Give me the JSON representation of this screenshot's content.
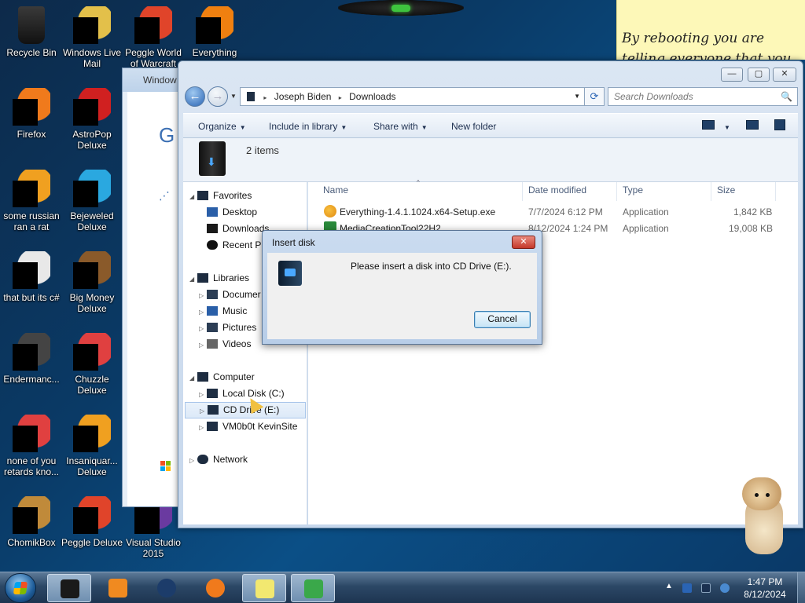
{
  "desktop": {
    "icons": [
      {
        "label": "Recycle Bin",
        "icon": "recycle-bin-icon",
        "color": "#2b2b2b"
      },
      {
        "label": "Windows Live Mail",
        "icon": "mail-icon",
        "color": "#e3c04a"
      },
      {
        "label": "Peggle World of Warcraft",
        "icon": "peggle-icon",
        "color": "#e0442a"
      },
      {
        "label": "Everything",
        "icon": "search-icon",
        "color": "#f08010"
      },
      {
        "label": "Firefox",
        "icon": "firefox-icon",
        "color": "#f07a1c"
      },
      {
        "label": "AstroPop Deluxe",
        "icon": "game-icon",
        "color": "#d02020"
      },
      {
        "label": "some russian ran a rat",
        "icon": "app-icon",
        "color": "#f0a020"
      },
      {
        "label": "Bejeweled Deluxe",
        "icon": "gem-icon",
        "color": "#2aa8e0"
      },
      {
        "label": "that but its c#",
        "icon": "file-icon",
        "color": "#e8e8e8"
      },
      {
        "label": "Big Money Deluxe",
        "icon": "money-icon",
        "color": "#8a5a2a"
      },
      {
        "label": "Endermanc...",
        "icon": "app-icon",
        "color": "#444444"
      },
      {
        "label": "Chuzzle Deluxe",
        "icon": "game-icon",
        "color": "#e04040"
      },
      {
        "label": "none of you retards kno...",
        "icon": "app-icon",
        "color": "#e04040"
      },
      {
        "label": "Insaniquar... Deluxe",
        "icon": "fish-icon",
        "color": "#f0a020"
      },
      {
        "label": "ChomikBox",
        "icon": "hamster-icon",
        "color": "#c08a3a"
      },
      {
        "label": "Peggle Deluxe",
        "icon": "peggle-icon",
        "color": "#e0442a"
      },
      {
        "label": "Visual Studio 2015",
        "icon": "visual-studio-icon",
        "color": "#6a3aa0"
      }
    ],
    "sticky_note": "By rebooting you are telling everyone that you are"
  },
  "background_window": {
    "title": "Window",
    "letter": "G",
    "spinner": "⋰"
  },
  "explorer": {
    "controls": {
      "minimize": "—",
      "maximize": "▢",
      "close": "✕"
    },
    "nav": {
      "back": "←",
      "forward": "→",
      "dropdown": "▼"
    },
    "address": {
      "segments": [
        "Joseph Biden",
        "Downloads"
      ],
      "separator": "▸",
      "dropdown": "▼"
    },
    "refresh": "⟳",
    "search": {
      "placeholder": "Search Downloads",
      "icon": "🔍"
    },
    "toolbar": {
      "organize": "Organize",
      "include_in_library": "Include in library",
      "share_with": "Share with",
      "new_folder": "New folder",
      "dropdown": "▼"
    },
    "info": {
      "count": "2 items"
    },
    "navpane": {
      "favorites": {
        "label": "Favorites",
        "items": [
          "Desktop",
          "Downloads",
          "Recent Pl"
        ]
      },
      "libraries": {
        "label": "Libraries",
        "items": [
          "Documer",
          "Music",
          "Pictures",
          "Videos"
        ]
      },
      "computer": {
        "label": "Computer",
        "items": [
          "Local Disk (C:)",
          "CD Drive (E:)",
          "VM0b0t KevinSite"
        ]
      },
      "network": {
        "label": "Network"
      },
      "expand_open": "◢",
      "expand_closed": "▷"
    },
    "columns": {
      "name": "Name",
      "date_modified": "Date modified",
      "type": "Type",
      "size": "Size",
      "sort": "^"
    },
    "files": [
      {
        "name": "Everything-1.4.1.1024.x64-Setup.exe",
        "date": "7/7/2024 6:12 PM",
        "type": "Application",
        "size": "1,842 KB",
        "icon_color": "#e08a10"
      },
      {
        "name": "MediaCreationTool22H2",
        "date": "8/12/2024 1:24 PM",
        "type": "Application",
        "size": "19,008 KB",
        "icon_color": "#2a8a3a"
      }
    ]
  },
  "dialog": {
    "title": "Insert disk",
    "close": "✕",
    "message": "Please insert a disk into CD Drive (E:).",
    "cancel": "Cancel"
  },
  "taskbar": {
    "buttons": [
      {
        "icon": "explorer-icon",
        "color": "#1a1a1a",
        "active": true
      },
      {
        "icon": "media-player-icon",
        "color": "#f08a20",
        "active": false
      },
      {
        "icon": "globe-icon",
        "color": "#1c3c6a",
        "active": false
      },
      {
        "icon": "firefox-icon",
        "color": "#f07a1c",
        "active": false
      },
      {
        "icon": "sticky-notes-icon",
        "color": "#f2e870",
        "active": true
      },
      {
        "icon": "setup-icon",
        "color": "#3aa84a",
        "active": true
      }
    ],
    "tray_arrow": "▲",
    "time": "1:47 PM",
    "date": "8/12/2024"
  }
}
